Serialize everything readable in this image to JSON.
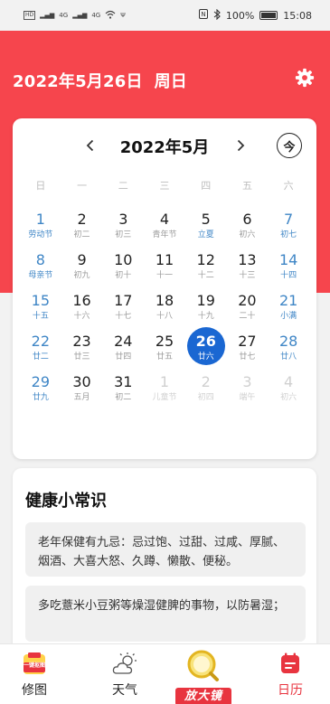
{
  "status_bar": {
    "left_badges": [
      "HD",
      "4G",
      "4G"
    ],
    "battery": "100%",
    "time": "15:08"
  },
  "header": {
    "date_text": "2022年5月26日  周日",
    "settings_icon": "gear-icon",
    "accent_color": "#f6454d"
  },
  "calendar": {
    "month_title": "2022年5月",
    "today_label": "今",
    "weekdays": [
      "日",
      "一",
      "二",
      "三",
      "四",
      "五",
      "六"
    ],
    "selected_color": "#1a67d2",
    "weekend_color": "#3f86c6",
    "days": [
      {
        "n": "1",
        "s": "劳动节",
        "weekend": true,
        "holiday": true
      },
      {
        "n": "2",
        "s": "初二"
      },
      {
        "n": "3",
        "s": "初三"
      },
      {
        "n": "4",
        "s": "青年节"
      },
      {
        "n": "5",
        "s": "立夏",
        "holiday": true
      },
      {
        "n": "6",
        "s": "初六"
      },
      {
        "n": "7",
        "s": "初七",
        "weekend": true
      },
      {
        "n": "8",
        "s": "母亲节",
        "weekend": true,
        "holiday": true
      },
      {
        "n": "9",
        "s": "初九"
      },
      {
        "n": "10",
        "s": "初十"
      },
      {
        "n": "11",
        "s": "十一"
      },
      {
        "n": "12",
        "s": "十二"
      },
      {
        "n": "13",
        "s": "十三"
      },
      {
        "n": "14",
        "s": "十四",
        "weekend": true
      },
      {
        "n": "15",
        "s": "十五",
        "weekend": true
      },
      {
        "n": "16",
        "s": "十六"
      },
      {
        "n": "17",
        "s": "十七"
      },
      {
        "n": "18",
        "s": "十八"
      },
      {
        "n": "19",
        "s": "十九"
      },
      {
        "n": "20",
        "s": "二十"
      },
      {
        "n": "21",
        "s": "小满",
        "weekend": true,
        "holiday": true
      },
      {
        "n": "22",
        "s": "廿二",
        "weekend": true
      },
      {
        "n": "23",
        "s": "廿三"
      },
      {
        "n": "24",
        "s": "廿四"
      },
      {
        "n": "25",
        "s": "廿五"
      },
      {
        "n": "26",
        "s": "廿六",
        "selected": true
      },
      {
        "n": "27",
        "s": "廿七"
      },
      {
        "n": "28",
        "s": "廿八",
        "weekend": true
      },
      {
        "n": "29",
        "s": "廿九",
        "weekend": true
      },
      {
        "n": "30",
        "s": "五月"
      },
      {
        "n": "31",
        "s": "初二"
      },
      {
        "n": "1",
        "s": "儿童节",
        "other": true
      },
      {
        "n": "2",
        "s": "初四",
        "other": true
      },
      {
        "n": "3",
        "s": "端午",
        "other": true
      },
      {
        "n": "4",
        "s": "初六",
        "other": true
      }
    ]
  },
  "health": {
    "title": "健康小常识",
    "tips": [
      "老年保健有九忌：忌过饱、过甜、过咸、厚腻、烟酒、大喜大怒、久蹲、懒散、便秘。",
      "多吃薏米小豆粥等燥湿健脾的事物，以防暑湿；"
    ]
  },
  "tabbar": {
    "edit_label": "修图",
    "edit_badge": "一键抠图",
    "weather_label": "天气",
    "magnify_label": "放大镜",
    "calendar_label": "日历",
    "active_color": "#e8343f"
  }
}
